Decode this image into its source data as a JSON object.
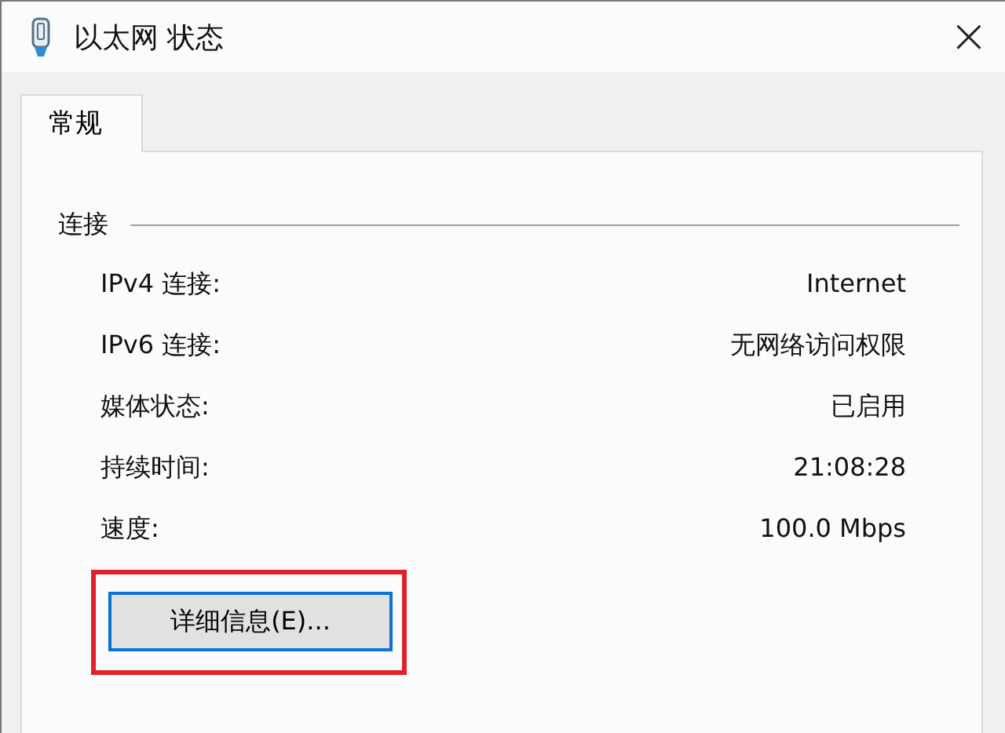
{
  "window": {
    "title": "以太网 状态",
    "close": "×"
  },
  "tabs": [
    {
      "label": "常规",
      "selected": true
    }
  ],
  "section": {
    "title": "连接"
  },
  "rows": [
    {
      "label": "IPv4 连接:",
      "value": "Internet"
    },
    {
      "label": "IPv6 连接:",
      "value": "无网络访问权限"
    },
    {
      "label": "媒体状态:",
      "value": "已启用"
    },
    {
      "label": "持续时间:",
      "value": "21:08:28"
    },
    {
      "label": "速度:",
      "value": "100.0 Mbps"
    }
  ],
  "details_button": {
    "label": "详细信息(E)...",
    "highlighted": true
  }
}
